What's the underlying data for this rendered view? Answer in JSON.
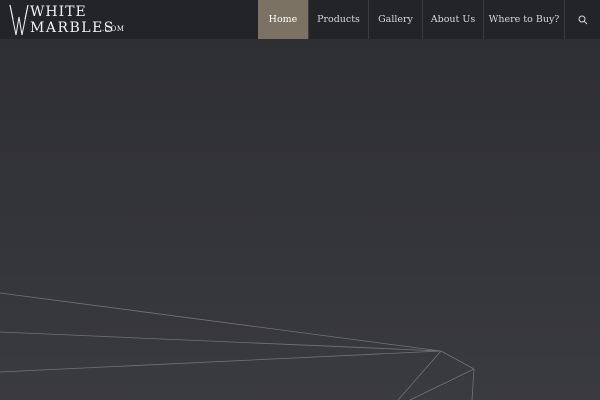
{
  "brand": {
    "line1": "WHITE",
    "line2": "MARBLES",
    "suffix": ".COM"
  },
  "nav": {
    "items": [
      {
        "label": "Home",
        "active": true
      },
      {
        "label": "Products",
        "active": false
      },
      {
        "label": "Gallery",
        "active": false
      },
      {
        "label": "About Us",
        "active": false
      },
      {
        "label": "Where to Buy?",
        "active": false
      }
    ],
    "search_icon": "search-icon"
  },
  "colors": {
    "header_bg": "#232428",
    "active_nav_bg": "#7b7264",
    "page_bg": "#2e2f33",
    "line_color": "#8a8b90"
  }
}
